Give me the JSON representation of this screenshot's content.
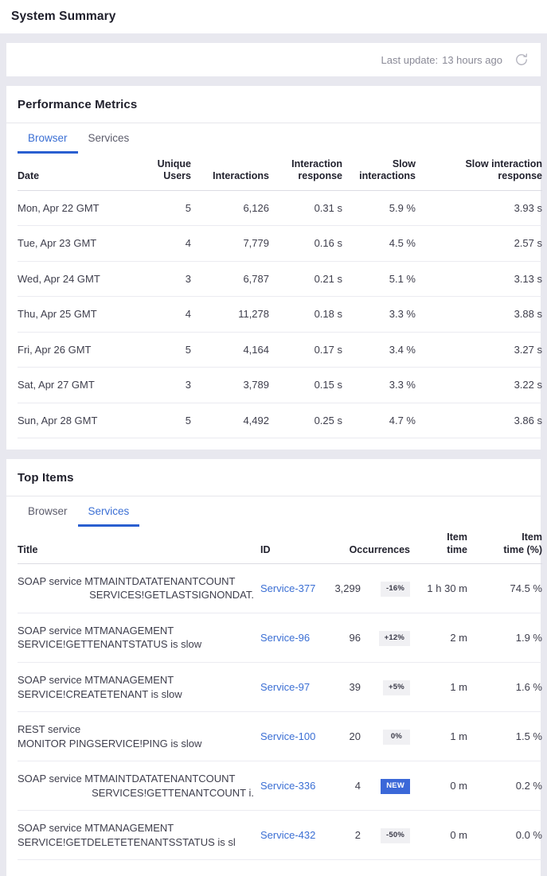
{
  "header": {
    "title": "System Summary"
  },
  "update_bar": {
    "label": "Last update:",
    "value": "13 hours ago",
    "refresh_icon": "refresh-icon"
  },
  "performance": {
    "title": "Performance Metrics",
    "tabs": [
      {
        "label": "Browser",
        "active": true
      },
      {
        "label": "Services",
        "active": false
      }
    ],
    "columns": [
      "Date",
      "Unique Users",
      "Interactions",
      "Interaction response",
      "Slow interactions",
      "Slow interaction response"
    ],
    "columns_lines": [
      {
        "l1": "",
        "l2": "Date"
      },
      {
        "l1": "Unique",
        "l2": "Users"
      },
      {
        "l1": "",
        "l2": "Interactions"
      },
      {
        "l1": "Interaction",
        "l2": "response"
      },
      {
        "l1": "Slow",
        "l2": "interactions"
      },
      {
        "l1": "Slow interaction",
        "l2": "response"
      }
    ],
    "rows": [
      {
        "date": "Mon, Apr 22 GMT",
        "unique_users": "5",
        "interactions": "6,126",
        "interaction_response": "0.31 s",
        "slow_interactions": "5.9 %",
        "slow_interaction_response": "3.93 s"
      },
      {
        "date": "Tue, Apr 23 GMT",
        "unique_users": "4",
        "interactions": "7,779",
        "interaction_response": "0.16 s",
        "slow_interactions": "4.5 %",
        "slow_interaction_response": "2.57 s"
      },
      {
        "date": "Wed, Apr 24 GMT",
        "unique_users": "3",
        "interactions": "6,787",
        "interaction_response": "0.21 s",
        "slow_interactions": "5.1 %",
        "slow_interaction_response": "3.13 s"
      },
      {
        "date": "Thu, Apr 25 GMT",
        "unique_users": "4",
        "interactions": "11,278",
        "interaction_response": "0.18 s",
        "slow_interactions": "3.3 %",
        "slow_interaction_response": "3.88 s"
      },
      {
        "date": "Fri, Apr 26 GMT",
        "unique_users": "5",
        "interactions": "4,164",
        "interaction_response": "0.17 s",
        "slow_interactions": "3.4 %",
        "slow_interaction_response": "3.27 s"
      },
      {
        "date": "Sat, Apr 27 GMT",
        "unique_users": "3",
        "interactions": "3,789",
        "interaction_response": "0.15 s",
        "slow_interactions": "3.3 %",
        "slow_interaction_response": "3.22 s"
      },
      {
        "date": "Sun, Apr 28 GMT",
        "unique_users": "5",
        "interactions": "4,492",
        "interaction_response": "0.25 s",
        "slow_interactions": "4.7 %",
        "slow_interaction_response": "3.86 s"
      }
    ]
  },
  "top_items": {
    "title": "Top Items",
    "tabs": [
      {
        "label": "Browser",
        "active": false
      },
      {
        "label": "Services",
        "active": true
      }
    ],
    "columns_lines": [
      {
        "l1": "",
        "l2": "Title"
      },
      {
        "l1": "",
        "l2": "ID"
      },
      {
        "l1": "",
        "l2": "Occurrences"
      },
      {
        "l1": "Item",
        "l2": "time"
      },
      {
        "l1": "Item",
        "l2": "time (%)"
      }
    ],
    "rows": [
      {
        "title_line1": "SOAP service MTMAINTDATATENANTCOUNT",
        "title_line2": "SERVICES!GETLASTSIGNONDAT.",
        "title_align_right": true,
        "id": "Service-377",
        "occurrences": "3,299",
        "badge": "-16%",
        "badge_kind": "neutral",
        "item_time": "1 h 30 m",
        "item_time_pct": "74.5 %"
      },
      {
        "title_line1": "SOAP service MTMANAGEMENT",
        "title_line2": "SERVICE!GETTENANTSTATUS is slow",
        "title_align_right": false,
        "id": "Service-96",
        "occurrences": "96",
        "badge": "+12%",
        "badge_kind": "neutral",
        "item_time": "2 m",
        "item_time_pct": "1.9 %"
      },
      {
        "title_line1": "SOAP service MTMANAGEMENT",
        "title_line2": "SERVICE!CREATETENANT is slow",
        "title_align_right": false,
        "id": "Service-97",
        "occurrences": "39",
        "badge": "+5%",
        "badge_kind": "neutral",
        "item_time": "1 m",
        "item_time_pct": "1.6 %"
      },
      {
        "title_line1": "REST service",
        "title_line2": "MONITOR PINGSERVICE!PING is slow",
        "title_align_right": false,
        "id": "Service-100",
        "occurrences": "20",
        "badge": "0%",
        "badge_kind": "neutral",
        "item_time": "1 m",
        "item_time_pct": "1.5 %"
      },
      {
        "title_line1": "SOAP service MTMAINTDATATENANTCOUNT",
        "title_line2": "SERVICES!GETTENANTCOUNT i.",
        "title_align_right": true,
        "id": "Service-336",
        "occurrences": "4",
        "badge": "NEW",
        "badge_kind": "new",
        "item_time": "0 m",
        "item_time_pct": "0.2 %"
      },
      {
        "title_line1": "SOAP service MTMANAGEMENT",
        "title_line2": "SERVICE!GETDELETETENANTSSTATUS is sl",
        "title_align_right": false,
        "id": "Service-432",
        "occurrences": "2",
        "badge": "-50%",
        "badge_kind": "neutral",
        "item_time": "0 m",
        "item_time_pct": "0.0 %"
      }
    ]
  },
  "colors": {
    "page_background": "#e8e8ef",
    "card_background": "#ffffff",
    "accent_blue": "#3b6fd4",
    "tab_underline": "#2a5fd0",
    "badge_new_background": "#3b68d8",
    "badge_neutral_background": "#f0f0f3",
    "text_primary": "#2b2b36",
    "text_muted": "#8a8a97"
  }
}
